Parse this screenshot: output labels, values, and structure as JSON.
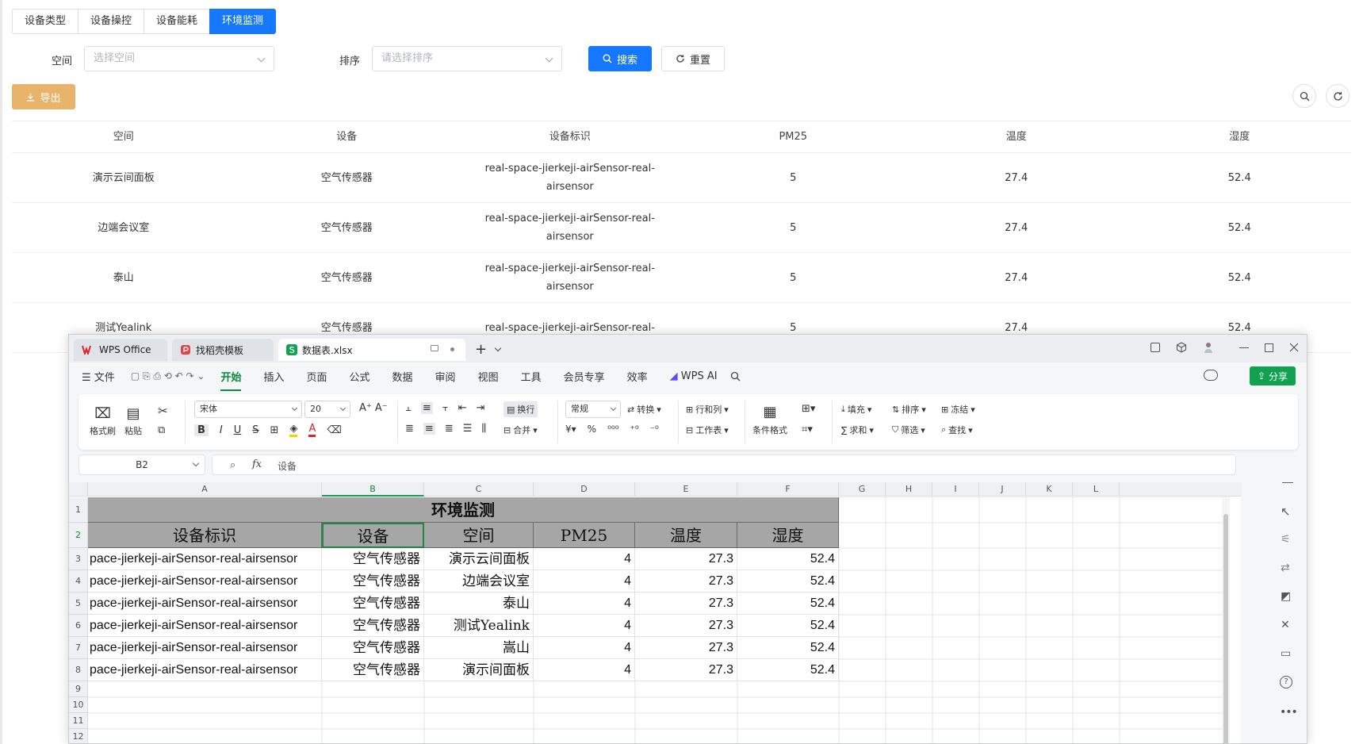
{
  "tabs": [
    "设备类型",
    "设备操控",
    "设备能耗",
    "环境监测"
  ],
  "active_tab": 3,
  "filters": {
    "space_label": "空间",
    "space_placeholder": "选择空间",
    "sort_label": "排序",
    "sort_placeholder": "请选择排序",
    "search_button": "搜索",
    "reset_button": "重置"
  },
  "toolbar": {
    "export_button": "导出"
  },
  "table": {
    "columns": [
      "空间",
      "设备",
      "设备标识",
      "PM25",
      "温度",
      "湿度"
    ],
    "rows": [
      [
        "演示云间面板",
        "空气传感器",
        "real-space-jierkeji-airSensor-real-airsensor",
        "5",
        "27.4",
        "52.4"
      ],
      [
        "边端会议室",
        "空气传感器",
        "real-space-jierkeji-airSensor-real-airsensor",
        "5",
        "27.4",
        "52.4"
      ],
      [
        "泰山",
        "空气传感器",
        "real-space-jierkeji-airSensor-real-airsensor",
        "5",
        "27.4",
        "52.4"
      ],
      [
        "测试Yealink",
        "空气传感器",
        "real-space-jierkeji-airSensor-real-",
        "5",
        "27.4",
        "52.4"
      ]
    ]
  },
  "wps": {
    "tabs": {
      "home": "WPS Office",
      "templates": "找稻壳模板",
      "file": "数据表.xlsx"
    },
    "menu": [
      "文件",
      "开始",
      "插入",
      "页面",
      "公式",
      "数据",
      "审阅",
      "视图",
      "工具",
      "会员专享",
      "效率",
      "WPS AI"
    ],
    "active_menu": "开始",
    "share_button": "分享",
    "ribbon": {
      "format_painter": "格式刷",
      "paste": "粘贴",
      "font_name": "宋体",
      "font_size": "20",
      "wrap": "换行",
      "merge": "合并",
      "number_format": "常规",
      "convert": "转换",
      "row_col": "行和列",
      "worksheet": "工作表",
      "cond_format": "条件格式",
      "fill": "填充",
      "sort": "排序",
      "freeze": "冻结",
      "sum": "求和",
      "filter": "筛选",
      "find": "查找"
    },
    "name_box": "B2",
    "formula_value": "设备",
    "columns": [
      "A",
      "B",
      "C",
      "D",
      "E",
      "F",
      "G",
      "H",
      "I",
      "J",
      "K",
      "L"
    ],
    "row_numbers": [
      "1",
      "2",
      "3",
      "4",
      "5",
      "6",
      "7",
      "8",
      "9",
      "10",
      "11",
      "12"
    ],
    "sheet_title": "环境监测",
    "sheet_headers": [
      "设备标识",
      "设备",
      "空间",
      "PM25",
      "温度",
      "湿度"
    ],
    "sheet_rows": [
      [
        "pace-jierkeji-airSensor-real-airsensor",
        "空气传感器",
        "演示云间面板",
        "4",
        "27.3",
        "52.4"
      ],
      [
        "pace-jierkeji-airSensor-real-airsensor",
        "空气传感器",
        "边端会议室",
        "4",
        "27.3",
        "52.4"
      ],
      [
        "pace-jierkeji-airSensor-real-airsensor",
        "空气传感器",
        "泰山",
        "4",
        "27.3",
        "52.4"
      ],
      [
        "pace-jierkeji-airSensor-real-airsensor",
        "空气传感器",
        "测试Yealink",
        "4",
        "27.3",
        "52.4"
      ],
      [
        "pace-jierkeji-airSensor-real-airsensor",
        "空气传感器",
        "嵩山",
        "4",
        "27.3",
        "52.4"
      ],
      [
        "pace-jierkeji-airSensor-real-airsensor",
        "空气传感器",
        "演示间面板",
        "4",
        "27.3",
        "52.4"
      ]
    ]
  },
  "colors": {
    "primary": "#1677ff",
    "export": "#e8b36a",
    "wps_green": "#0d8a3c"
  }
}
